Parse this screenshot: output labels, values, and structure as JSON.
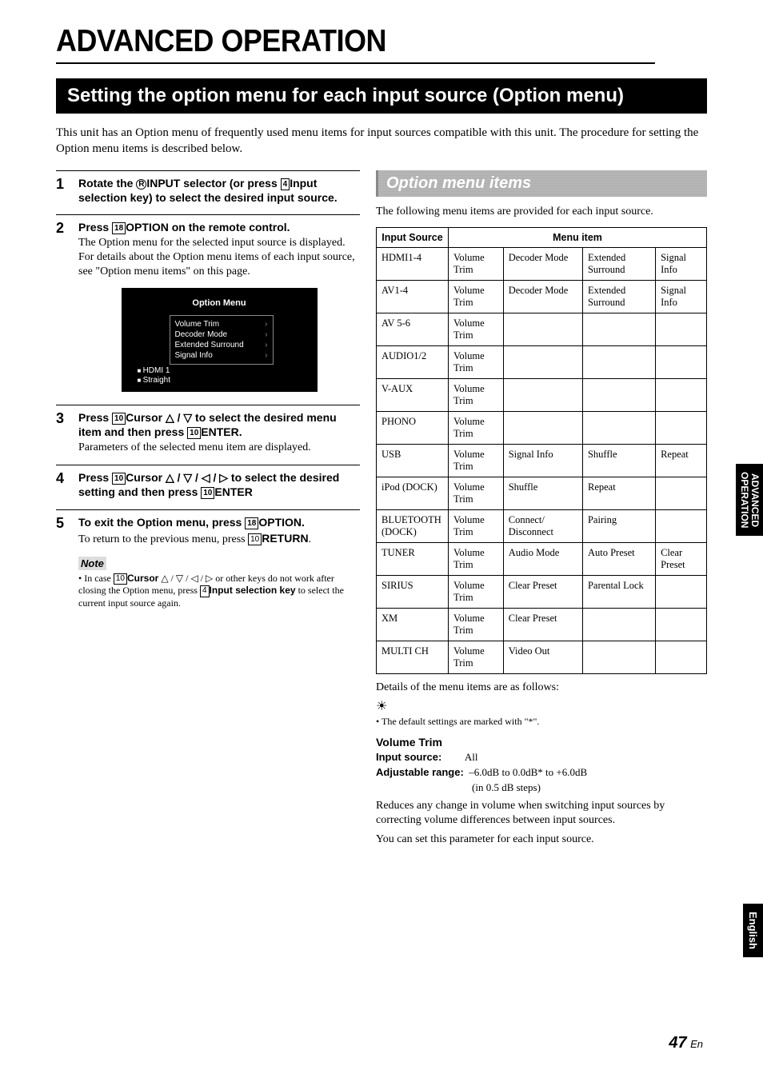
{
  "page_title": "ADVANCED OPERATION",
  "section_title": "Setting the option menu for each input source (Option menu)",
  "intro": "This unit has an Option menu of frequently used menu items for input sources compatible with this unit. The procedure for setting the Option menu items is described below.",
  "steps": [
    {
      "num": "1",
      "title_html": "Rotate the <span class=\"circlenum\">R</span><span class=\"keylabel\">INPUT</span> selector (or press <span class=\"boxnum\">4</span><span class=\"keylabel\">Input selection key</span>) to select the desired input source.",
      "desc": ""
    },
    {
      "num": "2",
      "title_html": "Press <span class=\"boxnum\">18</span><span class=\"keylabel\">OPTION</span> on the remote control.",
      "desc": "The Option menu for the selected input source is displayed. For details about the Option menu items of each input source, see \"Option menu items\" on this page."
    },
    {
      "num": "3",
      "title_html": "Press <span class=\"boxnum\">10</span><span class=\"keylabel\">Cursor</span> △ / ▽ to select the desired menu item and then press <span class=\"boxnum\">10</span><span class=\"keylabel\">ENTER</span>.",
      "desc": "Parameters of the selected menu item are displayed."
    },
    {
      "num": "4",
      "title_html": "Press <span class=\"boxnum\">10</span><span class=\"keylabel\">Cursor</span> △ / ▽ / ◁ / ▷ to select the desired setting and then press <span class=\"boxnum\">10</span><span class=\"keylabel\">ENTER</span>",
      "desc": ""
    },
    {
      "num": "5",
      "title_html": "To exit the Option menu, press <span class=\"boxnum\">18</span><span class=\"keylabel\">OPTION</span>.",
      "desc_html": "To return to the previous menu, press <span class=\"boxnum\">10</span><span class=\"keylabel\">RETURN</span>."
    }
  ],
  "osd": {
    "title": "Option Menu",
    "items": [
      "Volume Trim",
      "Decoder Mode",
      "Extended Surround",
      "Signal Info"
    ],
    "status": [
      "HDMI 1",
      "Straight"
    ]
  },
  "note_label": "Note",
  "note_html": "In case <span class=\"boxnum\">10</span><span class=\"keylabel\">Cursor</span> △ / ▽ / ◁ / ▷ or other keys do not work after closing the Option menu, press <span class=\"boxnum\">4</span><span class=\"keylabel\">Input selection key</span> to select the current input source again.",
  "sub_header": "Option menu items",
  "right_intro": "The following menu items are provided for each input source.",
  "table": {
    "h1": "Input Source",
    "h2": "Menu item",
    "rows": [
      [
        "HDMI1-4",
        "Volume Trim",
        "Decoder Mode",
        "Extended Surround",
        "Signal Info"
      ],
      [
        "AV1-4",
        "Volume Trim",
        "Decoder Mode",
        "Extended Surround",
        "Signal Info"
      ],
      [
        "AV 5-6",
        "Volume Trim",
        "",
        "",
        ""
      ],
      [
        "AUDIO1/2",
        "Volume Trim",
        "",
        "",
        ""
      ],
      [
        "V-AUX",
        "Volume Trim",
        "",
        "",
        ""
      ],
      [
        "PHONO",
        "Volume Trim",
        "",
        "",
        ""
      ],
      [
        "USB",
        "Volume Trim",
        "Signal Info",
        "Shuffle",
        "Repeat"
      ],
      [
        "iPod (DOCK)",
        "Volume Trim",
        "Shuffle",
        "Repeat",
        ""
      ],
      [
        "BLUETOOTH (DOCK)",
        "Volume Trim",
        "Connect/ Disconnect",
        "Pairing",
        ""
      ],
      [
        "TUNER",
        "Volume Trim",
        "Audio Mode",
        "Auto Preset",
        "Clear Preset"
      ],
      [
        "SIRIUS",
        "Volume Trim",
        "Clear Preset",
        "Parental Lock",
        ""
      ],
      [
        "XM",
        "Volume Trim",
        "Clear Preset",
        "",
        ""
      ],
      [
        "MULTI CH",
        "Volume Trim",
        "Video Out",
        "",
        ""
      ]
    ]
  },
  "after_table": "Details of the menu items are as follows:",
  "tip_icon": "☀",
  "tip_text": "The default settings are marked with \"*\".",
  "vol_trim": {
    "head": "Volume Trim",
    "input_label": "Input source:",
    "input_val": "All",
    "range_label": "Adjustable range:",
    "range_val": "–6.0dB to 0.0dB* to +6.0dB",
    "range_sub": "(in 0.5 dB steps)",
    "desc1": "Reduces any change in volume when switching input sources by correcting volume differences between input sources.",
    "desc2": "You can set this parameter for each input source."
  },
  "side_tab": "ADVANCED OPERATION",
  "side_tab2": "English",
  "page_num": "47",
  "page_suf": "En"
}
